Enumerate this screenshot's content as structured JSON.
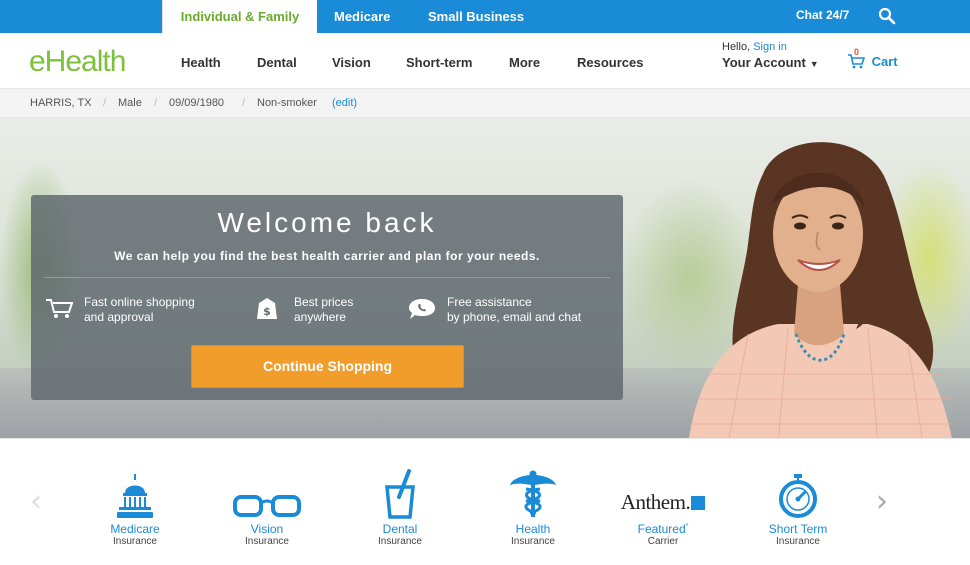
{
  "topbar": {
    "tabs": [
      {
        "label": "Individual & Family",
        "active": true
      },
      {
        "label": "Medicare"
      },
      {
        "label": "Small Business"
      }
    ],
    "chat_label": "Chat 24/7",
    "search_icon": "search-icon"
  },
  "header": {
    "logo": "eHealth",
    "nav": [
      "Health",
      "Dental",
      "Vision",
      "Short-term",
      "More",
      "Resources"
    ],
    "hello": "Hello,",
    "sign_in": "Sign in",
    "your_account": "Your Account",
    "cart_count": "0",
    "cart_label": "Cart"
  },
  "profile": {
    "location": "HARRIS, TX",
    "gender": "Male",
    "dob": "09/09/1980",
    "smoker": "Non-smoker",
    "edit": "(edit)"
  },
  "hero": {
    "title": "Welcome back",
    "subtitle": "We can help you find the best health carrier and plan for your needs.",
    "features": [
      {
        "icon": "cart-icon",
        "line1": "Fast online shopping",
        "line2": "and approval"
      },
      {
        "icon": "price-tag-icon",
        "line1": "Best prices",
        "line2": "anywhere"
      },
      {
        "icon": "chat-bubble-icon",
        "line1": "Free assistance",
        "line2": "by phone, email and chat"
      }
    ],
    "cta": "Continue Shopping"
  },
  "products": [
    {
      "icon": "capitol-icon",
      "name": "Medicare",
      "kind": "Insurance"
    },
    {
      "icon": "glasses-icon",
      "name": "Vision",
      "kind": "Insurance"
    },
    {
      "icon": "toothbrush-cup-icon",
      "name": "Dental",
      "kind": "Insurance"
    },
    {
      "icon": "caduceus-icon",
      "name": "Health",
      "kind": "Insurance"
    },
    {
      "icon": "anthem-logo",
      "logo_text": "Anthem.",
      "name": "Featured",
      "kind": "Carrier"
    },
    {
      "icon": "stopwatch-icon",
      "name": "Short Term",
      "kind": "Insurance"
    }
  ],
  "colors": {
    "brand_blue": "#1a8bd6",
    "brand_green": "#7cc03b",
    "cta_orange": "#f09d2c"
  }
}
